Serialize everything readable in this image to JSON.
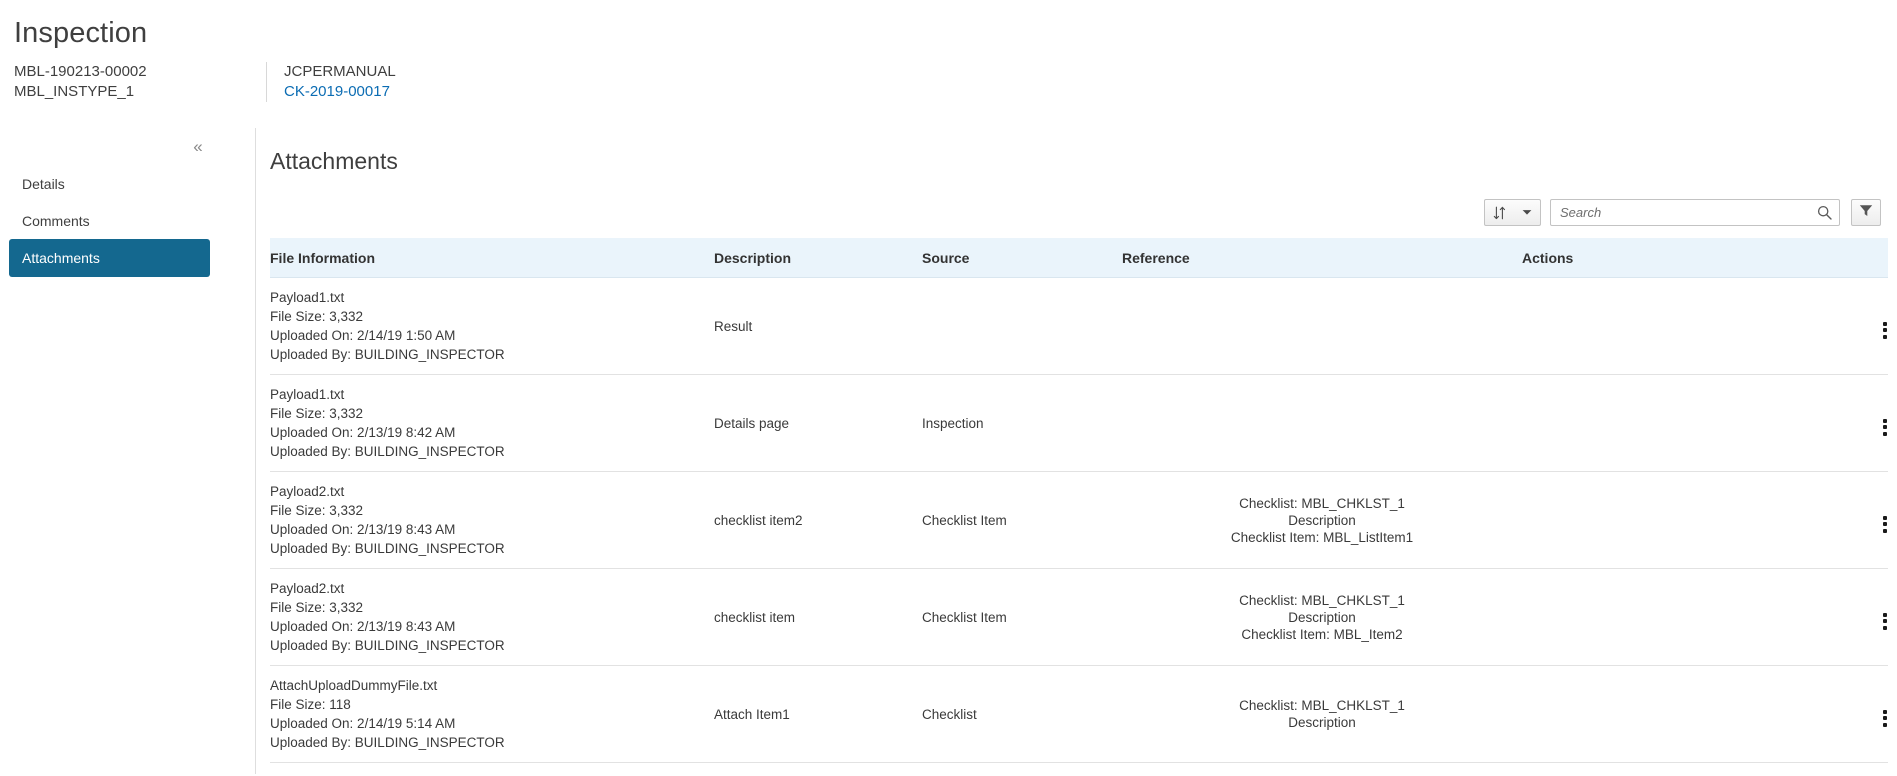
{
  "header": {
    "title": "Inspection",
    "record_id": "MBL-190213-00002",
    "record_type": "MBL_INSTYPE_1",
    "secondary_label": "JCPERMANUAL",
    "secondary_link": "CK-2019-00017"
  },
  "sidebar": {
    "collapse_icon": "double-chevron-left",
    "items": [
      {
        "label": "Details",
        "active": false
      },
      {
        "label": "Comments",
        "active": false
      },
      {
        "label": "Attachments",
        "active": true
      }
    ],
    "active_color": "#14688f"
  },
  "panel": {
    "title": "Attachments"
  },
  "toolbar": {
    "sort_icon": "sort-arrows-icon",
    "sort_caret_icon": "chevron-down-icon",
    "search_placeholder": "Search",
    "search_value": "",
    "search_icon": "magnifier-icon",
    "filter_icon": "funnel-icon"
  },
  "table": {
    "columns": [
      "File Information",
      "Description",
      "Source",
      "Reference",
      "Actions"
    ],
    "row_action_icon": "vertical-ellipsis-icon",
    "rows": [
      {
        "file_name": "Payload1.txt",
        "file_size": "File Size: 3,332",
        "uploaded_on": "Uploaded On: 2/14/19 1:50 AM",
        "uploaded_by": "Uploaded By: BUILDING_INSPECTOR",
        "description": "Result",
        "source": "",
        "reference": []
      },
      {
        "file_name": "Payload1.txt",
        "file_size": "File Size: 3,332",
        "uploaded_on": "Uploaded On: 2/13/19 8:42 AM",
        "uploaded_by": "Uploaded By: BUILDING_INSPECTOR",
        "description": "Details page",
        "source": "Inspection",
        "reference": []
      },
      {
        "file_name": "Payload2.txt",
        "file_size": "File Size: 3,332",
        "uploaded_on": "Uploaded On: 2/13/19 8:43 AM",
        "uploaded_by": "Uploaded By: BUILDING_INSPECTOR",
        "description": "checklist item2",
        "source": "Checklist Item",
        "reference": [
          "Checklist: MBL_CHKLST_1",
          "Description",
          "Checklist Item: MBL_ListItem1"
        ]
      },
      {
        "file_name": "Payload2.txt",
        "file_size": "File Size: 3,332",
        "uploaded_on": "Uploaded On: 2/13/19 8:43 AM",
        "uploaded_by": "Uploaded By: BUILDING_INSPECTOR",
        "description": "checklist item",
        "source": "Checklist Item",
        "reference": [
          "Checklist: MBL_CHKLST_1",
          "Description",
          "Checklist Item: MBL_Item2"
        ]
      },
      {
        "file_name": "AttachUploadDummyFile.txt",
        "file_size": "File Size: 118",
        "uploaded_on": "Uploaded On: 2/14/19 5:14 AM",
        "uploaded_by": "Uploaded By: BUILDING_INSPECTOR",
        "description": "Attach Item1",
        "source": "Checklist",
        "reference": [
          "Checklist: MBL_CHKLST_1",
          "Description"
        ]
      }
    ]
  }
}
